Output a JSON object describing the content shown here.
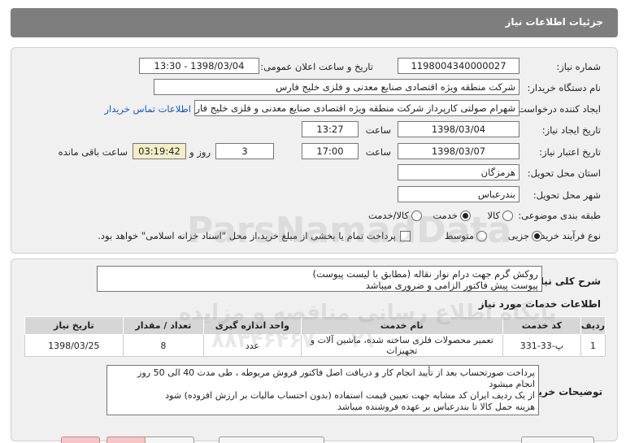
{
  "header": {
    "title": "جزئیات اطلاعات نیاز"
  },
  "fields": {
    "need_number_label": "شماره نیاز:",
    "need_number": "1198004340000027",
    "announce_label": "تاریخ و ساعت اعلان عمومی:",
    "announce_value": "1398/03/04 - 13:30",
    "buyer_org_label": "نام دستگاه خریدار:",
    "buyer_org": "شرکت منطقه ویژه اقتصادی صنایع معدنی و فلزی خلیج فارس",
    "requester_label": "ایجاد کننده درخواست:",
    "requester": "شهرام صولتی کارپرداز شرکت منطقه ویژه اقتصادی صنایع معدنی و فلزی خلیج فارس",
    "contact_link": "اطلاعات تماس خریدار",
    "create_date_label": "تاریخ ایجاد نیاز:",
    "create_date": "1398/03/04",
    "time_label": "ساعت",
    "create_time": "13:27",
    "valid_date_label": "تاریخ اعتبار نیاز:",
    "valid_date": "1398/03/07",
    "valid_time": "17:00",
    "days": "3",
    "day_and_label": "روز و",
    "remaining_time": "03:19:42",
    "remaining_label": "ساعت باقی مانده",
    "province_label": "استان محل تحویل:",
    "province": "هرمزگان",
    "city_label": "شهر محل تحویل:",
    "city": "بندرعباس",
    "category_label": "طبقه بندی موضوعی:",
    "category_options": [
      "کالا",
      "خدمت",
      "کالا/خدمت"
    ],
    "category_selected": "خدمت",
    "process_label": "نوع فرآیند خرید :",
    "process_options": [
      "جزیی",
      "متوسط"
    ],
    "process_selected": "جزیی",
    "payment_note": "پرداخت تمام یا بخشی از مبلغ خرید،از محل \"اسناد خزانه اسلامی\" خواهد بود."
  },
  "summary": {
    "label": "شرح کلی نیاز:",
    "line1": "روکش گرم جهت درام نوار نقاله (مطابق با لیست پیوست)",
    "line2": "پیوست پیش فاکتور الزامی و ضروری میباشد"
  },
  "services": {
    "title": "اطلاعات خدمات مورد نیاز",
    "headers": [
      "ردیف",
      "کد خدمت",
      "نام خدمت",
      "واحد اندازه گیری",
      "تعداد / مقدار",
      "تاریخ نیاز"
    ],
    "rows": [
      [
        "1",
        "پ-33-331",
        "تعمیر محصولات فلزی ساخته شده، ماشین آلات و تجهیزات",
        "عدد",
        "8",
        "1398/03/25"
      ]
    ]
  },
  "notes": {
    "label": "توضیحات خریدار:",
    "lines": [
      "پرداخت صورتحساب بعد از تأیید انجام کار و دریافت اصل فاکتور فروش مربوطه ، طی مدت 40 الی 50 روز",
      "انجام میشود",
      "از یک ردیف ایران کد مشابه جهت تعیین قیمت استفاده (بدون احتساب مالیات بر ارزش افزوده) شود",
      "هزینه حمل کالا تا بندرعباس بر عهده فروشنده میباشد"
    ]
  },
  "watermark": {
    "brand": "ParsNamadData",
    "line1": "پایگاه اطلاع رسانی مناقصه و مزایده",
    "line2": "۰۲۱ - ۸۸۳۴۶۴۶۷"
  },
  "colors": {
    "header_bg": "#7e7e7e",
    "panel_bg": "#f0f0f0",
    "link": "#1a56c4",
    "remaining_bg": "#f3eec7"
  }
}
